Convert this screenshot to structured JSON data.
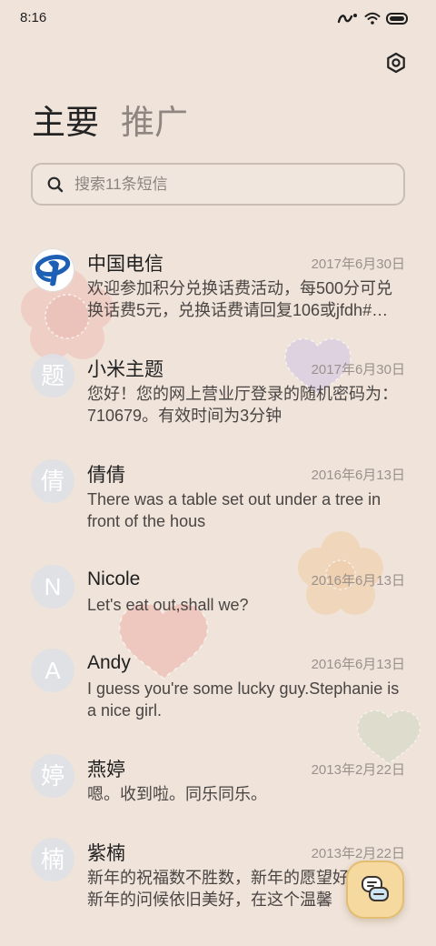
{
  "status_bar": {
    "time": "8:16",
    "icons": [
      "signal-icon",
      "wifi-icon",
      "battery-icon"
    ]
  },
  "header": {
    "settings_icon": "settings-icon"
  },
  "tabs": [
    {
      "label": "主要",
      "active": true
    },
    {
      "label": "推广",
      "active": false
    }
  ],
  "search": {
    "placeholder": "搜索11条短信",
    "value": "",
    "icon": "search-icon"
  },
  "conversations": [
    {
      "avatar_icon": "china-telecom-logo",
      "name": "中国电信",
      "date": "2017年6月30日",
      "preview": "欢迎参加积分兑换话费活动，每500分可兑换话费5元，兑换话费请回复106或jfdh#…"
    },
    {
      "avatar_text": "题",
      "name": "小米主题",
      "date": "2017年6月30日",
      "preview": "您好！您的网上营业厅登录的随机密码为：710679。有效时间为3分钟"
    },
    {
      "avatar_text": "倩",
      "name": "倩倩",
      "date": "2016年6月13日",
      "preview": "There was a table set out under a tree in front of the hous"
    },
    {
      "avatar_text": "N",
      "name": "Nicole",
      "date": "2016年6月13日",
      "preview": "Let's eat out,shall we?"
    },
    {
      "avatar_text": "A",
      "name": "Andy",
      "date": "2016年6月13日",
      "preview": "I guess you're some lucky guy.Stephanie is a nice girl."
    },
    {
      "avatar_text": "婷",
      "name": "燕婷",
      "date": "2013年2月22日",
      "preview": "嗯。收到啦。同乐同乐。"
    },
    {
      "avatar_text": "楠",
      "name": "紫楠",
      "date": "2013年2月22日",
      "preview": "新年的祝福数不胜数，新年的愿望好多多，新年的问候依旧美好，在这个温馨"
    }
  ],
  "fab": {
    "icon": "new-message-icon"
  },
  "theme": {
    "background": "#efe3da",
    "fab_color": "#f5d99f",
    "logo_blue": "#1d5fb5",
    "avatar_color": "#dee0e5"
  }
}
